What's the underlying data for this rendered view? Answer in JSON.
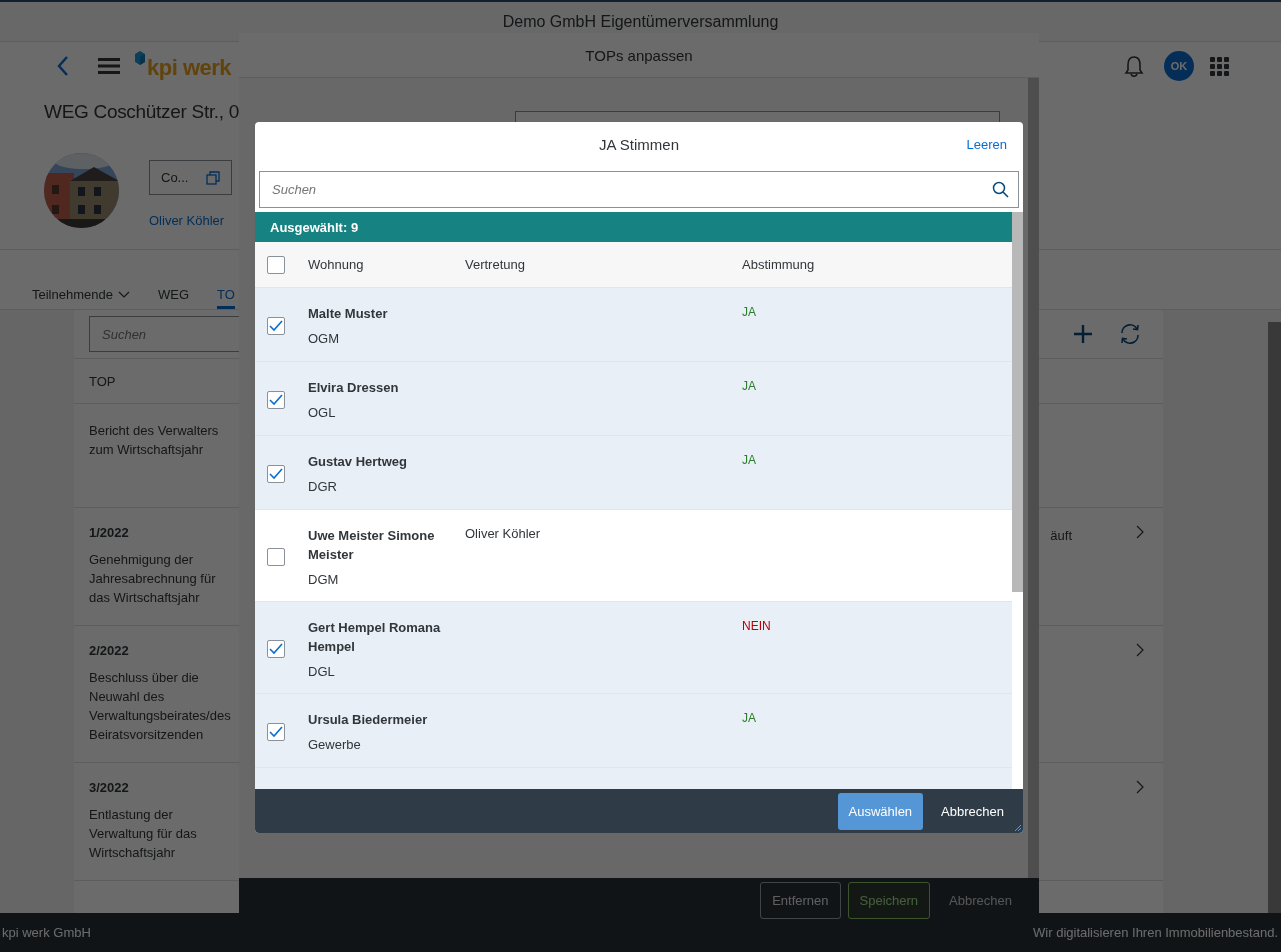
{
  "shell": {
    "title": "Demo GmbH Eigentümerversammlung"
  },
  "header": {
    "logo": "kpi werk",
    "avatar": "OK"
  },
  "object": {
    "title": "WEG Coschützer Str., 0",
    "button": "Co...",
    "link": "Oliver Köhler"
  },
  "tabs": [
    {
      "label": "Teilnehmende",
      "selected": false,
      "kind": "menu"
    },
    {
      "label": "WEG",
      "selected": false,
      "kind": "plain"
    },
    {
      "label": "TO",
      "selected": true,
      "kind": "plain"
    }
  ],
  "tops": {
    "search_placeholder": "Suchen",
    "columns": [
      "TOP"
    ],
    "rows": [
      {
        "text": "Bericht des Verwalters zum Wirtschaftsjahr",
        "navigable": false
      },
      {
        "number": "1/2022",
        "text": "Genehmigung der Jahresabrechnung für das Wirtschaftsjahr",
        "column_2": "äuft",
        "navigable": true
      },
      {
        "number": "2/2022",
        "text": "Beschluss über die Neuwahl des Verwaltungsbeirates/des Beiratsvorsitzenden",
        "navigable": true
      },
      {
        "number": "3/2022",
        "text": "Entlastung der Verwaltung für das Wirtschaftsjahr",
        "navigable": true
      }
    ]
  },
  "footer": {
    "left": "kpi werk GmbH",
    "right": "Wir digitalisieren Ihren Immobilienbestand."
  },
  "tops_dialog": {
    "title": "TOPs anpassen",
    "buttons": [
      {
        "label": "Entfernen",
        "kind": "default"
      },
      {
        "label": "Speichern",
        "kind": "accept"
      },
      {
        "label": "Abbrechen",
        "kind": "transparent"
      }
    ]
  },
  "votes_dialog": {
    "title": "JA Stimmen",
    "clear": "Leeren",
    "search_placeholder": "Suchen",
    "info": "Ausgewählt: 9",
    "select_all_checked": false,
    "columns": [
      "Wohnung",
      "Vertretung",
      "Abstimmung"
    ],
    "rows": [
      {
        "name": "Malte Muster",
        "unit": "OGM",
        "vote": "JA",
        "color": "#2b7d2b",
        "selected": true
      },
      {
        "name": "Elvira Dressen",
        "unit": "OGL",
        "vote": "JA",
        "color": "#2b7d2b",
        "selected": true
      },
      {
        "name": "Gustav Hertweg",
        "unit": "DGR",
        "vote": "JA",
        "color": "#2b7d2b",
        "selected": true
      },
      {
        "name": "Uwe Meister Simone Meister",
        "unit": "DGM",
        "proxy": "Oliver Köhler",
        "selected": false
      },
      {
        "name": "Gert Hempel Romana Hempel",
        "unit": "DGL",
        "vote": "NEIN",
        "color": "#bb0000",
        "selected": true
      },
      {
        "name": "Ursula Biedermeier",
        "unit": "Gewerbe",
        "vote": "JA",
        "color": "#2b7d2b",
        "selected": true
      }
    ],
    "buttons": [
      {
        "label": "Auswählen",
        "kind": "emphasized"
      },
      {
        "label": "Abbrechen",
        "kind": "transparent"
      }
    ]
  }
}
